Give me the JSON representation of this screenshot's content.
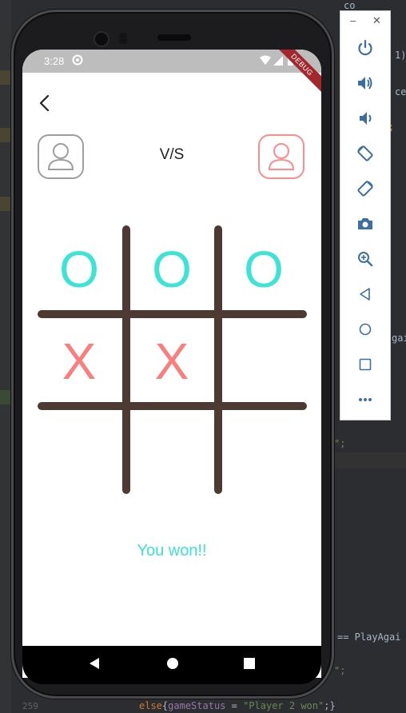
{
  "ide": {
    "line_number": "259",
    "else_keyword": "else",
    "else_brace": "{",
    "var_name": "gameStatus",
    "assign": " = ",
    "string_value": "\"Player 2 won\"",
    "tail": ";}",
    "frag_1": "1)",
    "frag_ce": "ce",
    "frag_semicolon": ";",
    "frag_agai": "gai",
    "frag_quote1": "\";",
    "frag_playagain": "== PlayAgai",
    "frag_quote2": "\";",
    "frag_co": "co"
  },
  "status_bar": {
    "time": "3:28",
    "debug_label": "DEBUG"
  },
  "header": {
    "vs_label": "V/S"
  },
  "board": {
    "cells": [
      "O",
      "O",
      "O",
      "X",
      "X",
      "",
      "",
      "",
      ""
    ]
  },
  "game": {
    "status_message": "You won!!"
  },
  "colors": {
    "o_color": "#3de3d4",
    "x_color": "#fb7e7e",
    "grid_color": "#4d3a32",
    "player2_border": "#ff8b8b",
    "player1_border": "#9e9e9e"
  },
  "icons": {
    "back": "back-arrow-icon",
    "player1": "user-avatar-icon",
    "player2": "user-avatar-icon",
    "emulator_toolbar": [
      "power-icon",
      "volume-up-icon",
      "volume-down-icon",
      "rotate-left-icon",
      "rotate-right-icon",
      "camera-icon",
      "zoom-icon",
      "back-icon",
      "home-icon",
      "overview-icon",
      "more-icon"
    ]
  }
}
